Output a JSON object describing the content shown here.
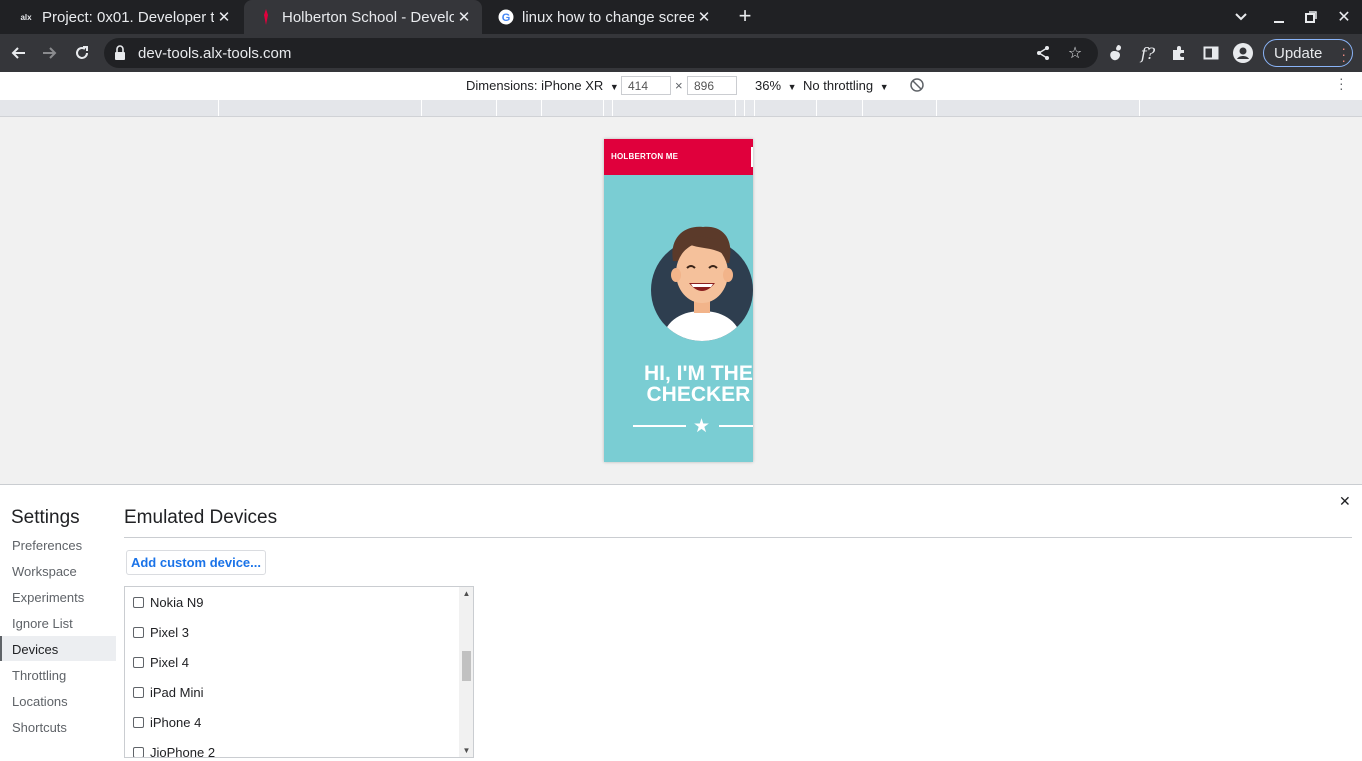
{
  "browser": {
    "tabs": [
      {
        "title": "Project: 0x01. Developer t",
        "favicon": "alx"
      },
      {
        "title": "Holberton School - Develo",
        "favicon": "holberton"
      },
      {
        "title": "linux how to change scree",
        "favicon": "G"
      }
    ],
    "url": "dev-tools.alx-tools.com",
    "update_label": "Update"
  },
  "device_toolbar": {
    "dimensions_label": "Dimensions: iPhone XR",
    "width": "414",
    "times": "×",
    "height": "896",
    "zoom": "36%",
    "throttling": "No throttling"
  },
  "page": {
    "brand": "HOLBERTON ME",
    "hero_line1": "HI, I'M THE",
    "hero_line2": "CHECKER"
  },
  "settings": {
    "title": "Settings",
    "nav": [
      "Preferences",
      "Workspace",
      "Experiments",
      "Ignore List",
      "Devices",
      "Throttling",
      "Locations",
      "Shortcuts"
    ],
    "selected_nav": "Devices",
    "section_title": "Emulated Devices",
    "add_button": "Add custom device...",
    "devices": [
      "Nokia N9",
      "Pixel 3",
      "Pixel 4",
      "iPad Mini",
      "iPhone 4",
      "JioPhone 2"
    ]
  },
  "colors": {
    "page_header": "#e0003c",
    "page_bg": "#7acdd3",
    "link_blue": "#1a73e8"
  }
}
